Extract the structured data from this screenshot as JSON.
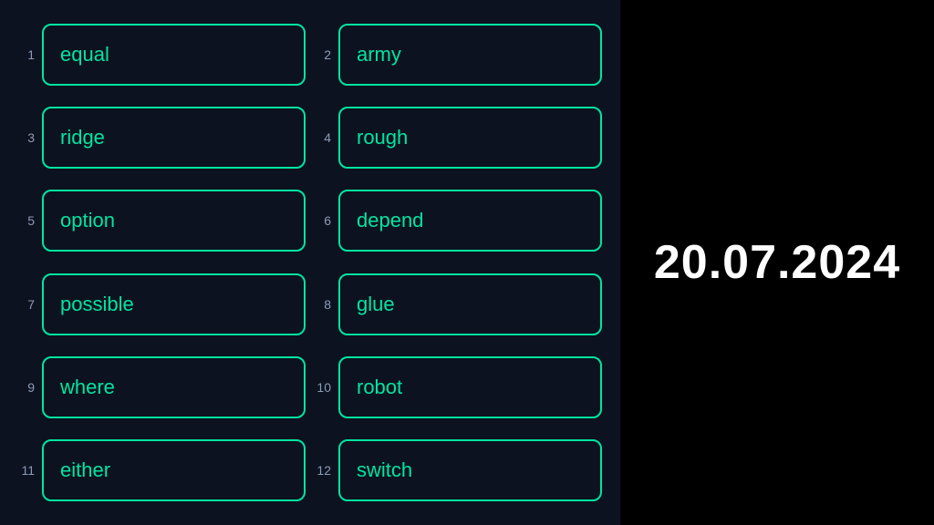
{
  "words": [
    {
      "number": "1",
      "text": "equal"
    },
    {
      "number": "2",
      "text": "army"
    },
    {
      "number": "3",
      "text": "ridge"
    },
    {
      "number": "4",
      "text": "rough"
    },
    {
      "number": "5",
      "text": "option"
    },
    {
      "number": "6",
      "text": "depend"
    },
    {
      "number": "7",
      "text": "possible"
    },
    {
      "number": "8",
      "text": "glue"
    },
    {
      "number": "9",
      "text": "where"
    },
    {
      "number": "10",
      "text": "robot"
    },
    {
      "number": "11",
      "text": "either"
    },
    {
      "number": "12",
      "text": "switch"
    }
  ],
  "date": "20.07.2024"
}
